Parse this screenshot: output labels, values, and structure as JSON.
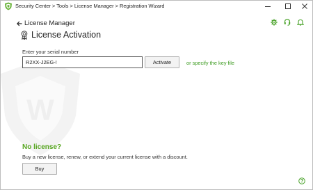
{
  "window": {
    "title": "Security Center > Tools > License Manager > Registration Wizard"
  },
  "header": {
    "back_label": "License Manager",
    "title": "License Activation"
  },
  "serial": {
    "label": "Enter your serial number",
    "value": "R2XX-J2EG-!",
    "activate_label": "Activate",
    "keyfile_link": "or specify the key file"
  },
  "no_license": {
    "title": "No license?",
    "description": "Buy a new license, renew, or extend your current license with a discount.",
    "buy_label": "Buy"
  },
  "icons": {
    "app": "shield-logo-icon",
    "settings": "gear-icon",
    "support": "headset-icon",
    "notifications": "bell-icon",
    "help": "question-icon",
    "title": "award-ribbon-icon",
    "back": "arrow-left-icon"
  },
  "colors": {
    "accent": "#56a51f",
    "link": "#3a9a1e",
    "watermark": "#f1f1f1"
  }
}
